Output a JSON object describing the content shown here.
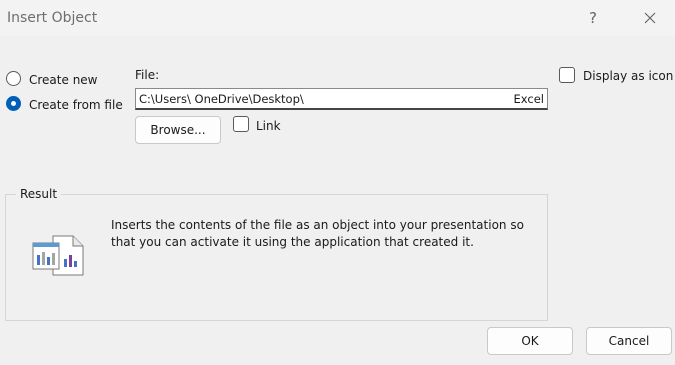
{
  "window": {
    "title": "Insert Object",
    "help_glyph": "?",
    "close_icon": "close-icon"
  },
  "options": {
    "create_new": "Create new",
    "create_from_file": "Create from file",
    "selected": "create_from_file"
  },
  "file": {
    "label": "File:",
    "value": "C:\\Users\\        OneDrive\\Desktop\\",
    "suffix": "Excel"
  },
  "buttons": {
    "browse": "Browse...",
    "ok": "OK",
    "cancel": "Cancel"
  },
  "checkboxes": {
    "link": "Link",
    "link_checked": false,
    "display_as_icon": "Display as icon",
    "display_as_icon_checked": false
  },
  "result": {
    "legend": "Result",
    "text": "Inserts the contents of the file as an object into your presentation so that you can activate it using the application that created it.",
    "icon": "embedded-file-icon"
  },
  "colors": {
    "accent": "#005fb8"
  }
}
